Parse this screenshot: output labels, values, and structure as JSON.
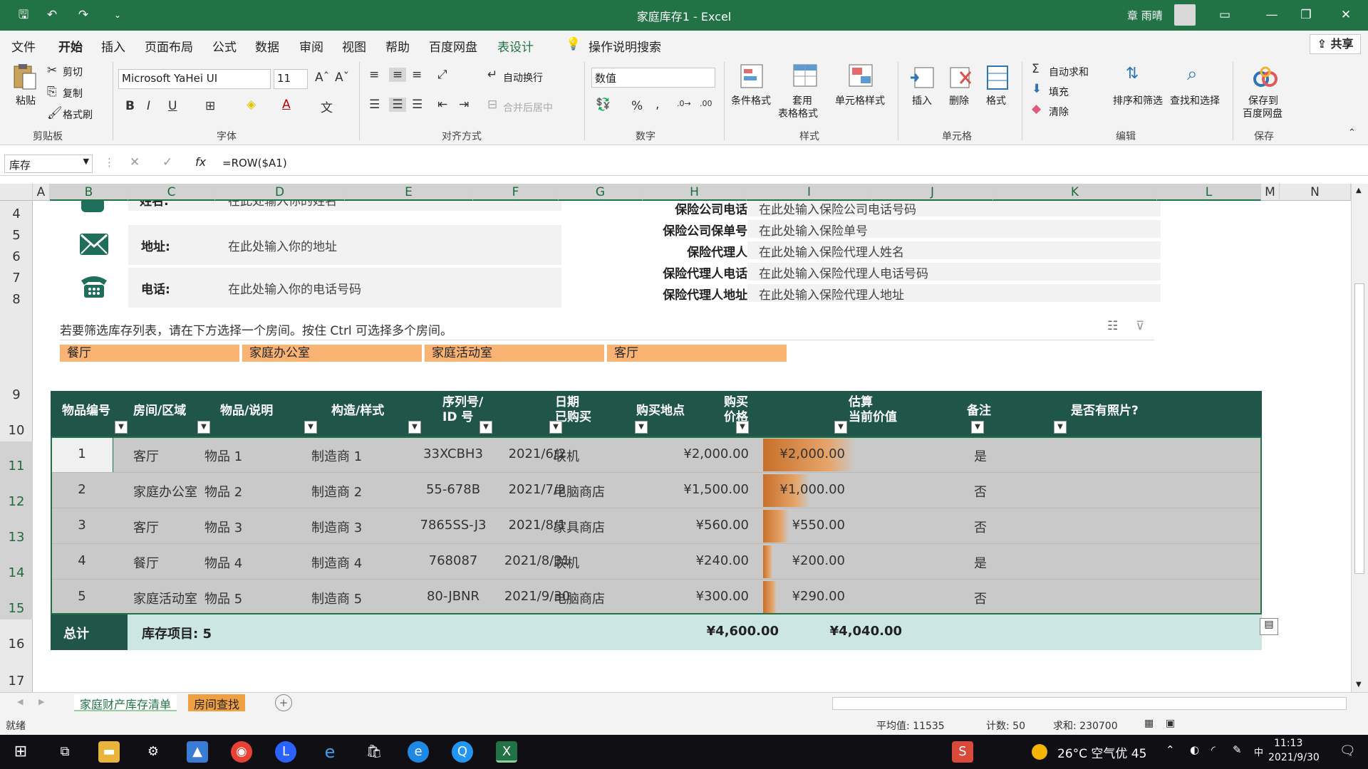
{
  "window": {
    "title": "家庭库存1  -  Excel",
    "user": "章 雨晴"
  },
  "menu": {
    "items": [
      "文件",
      "开始",
      "插入",
      "页面布局",
      "公式",
      "数据",
      "审阅",
      "视图",
      "帮助",
      "百度网盘",
      "表设计"
    ],
    "active": "开始",
    "search_label": "操作说明搜索",
    "share_label": "共享"
  },
  "ribbon": {
    "clipboard": {
      "paste": "粘贴",
      "cut": "剪切",
      "copy": "复制",
      "format_painter": "格式刷",
      "group": "剪贴板"
    },
    "font": {
      "name": "Microsoft YaHei UI",
      "size": "11",
      "bold": "B",
      "italic": "I",
      "underline": "U",
      "group": "字体"
    },
    "alignment": {
      "wrap": "自动换行",
      "merge": "合并后居中",
      "group": "对齐方式"
    },
    "number": {
      "format": "数值",
      "percent": "%",
      "comma": ",",
      "group": "数字"
    },
    "styles": {
      "conditional": "条件格式",
      "table_format_1": "套用",
      "table_format_2": "表格格式",
      "cell_styles": "单元格样式",
      "group": "样式"
    },
    "cells": {
      "insert": "插入",
      "delete": "删除",
      "format": "格式",
      "group": "单元格"
    },
    "editing": {
      "autosum": "自动求和",
      "fill": "填充",
      "clear": "清除",
      "sort_filter": "排序和筛选",
      "find_select": "查找和选择",
      "group": "编辑"
    },
    "save": {
      "save_to_1": "保存到",
      "save_to_2": "百度网盘",
      "group": "保存"
    }
  },
  "formula_bar": {
    "name_box": "库存",
    "formula": "=ROW($A1)",
    "fx": "fx"
  },
  "columns": [
    "A",
    "B",
    "C",
    "D",
    "E",
    "F",
    "G",
    "H",
    "I",
    "J",
    "K",
    "L",
    "M",
    "N"
  ],
  "rows": [
    "4",
    "5",
    "6",
    "7",
    "8",
    "9",
    "10",
    "11",
    "12",
    "13",
    "14",
    "15",
    "16",
    "17"
  ],
  "personal_info": {
    "name_label": "姓名:",
    "name_value": "在此处输入你的姓名",
    "address_label": "地址:",
    "address_value": "在此处输入你的地址",
    "phone_label": "电话:",
    "phone_value": "在此处输入你的电话号码"
  },
  "insurance_info": [
    {
      "label": "保险公司电话:",
      "value": "在此处输入保险公司电话号码"
    },
    {
      "label": "保险公司保单号:",
      "value": "在此处输入保险单号"
    },
    {
      "label": "保险代理人:",
      "value": "在此处输入保险代理人姓名"
    },
    {
      "label": "保险代理人电话:",
      "value": "在此处输入保险代理人电话号码"
    },
    {
      "label": "保险代理人地址:",
      "value": "在此处输入保险代理人地址"
    }
  ],
  "slicer": {
    "instruction": "若要筛选库存列表，请在下方选择一个房间。按住 Ctrl 可选择多个房间。",
    "buttons": [
      "餐厅",
      "家庭办公室",
      "家庭活动室",
      "客厅"
    ]
  },
  "table": {
    "headers": [
      {
        "line1": "物品编号",
        "line2": ""
      },
      {
        "line1": "房间/区域",
        "line2": ""
      },
      {
        "line1": "物品/说明",
        "line2": ""
      },
      {
        "line1": "构造/样式",
        "line2": ""
      },
      {
        "line1": "序列号/",
        "line2": "ID 号"
      },
      {
        "line1": "日期",
        "line2": "已购买"
      },
      {
        "line1": "购买地点",
        "line2": ""
      },
      {
        "line1": "购买",
        "line2": "价格"
      },
      {
        "line1": "估算",
        "line2": "当前价值"
      },
      {
        "line1": "备注",
        "line2": ""
      },
      {
        "line1": "是否有照片?",
        "line2": ""
      }
    ],
    "rows": [
      {
        "id": "1",
        "room": "客厅",
        "item": "物品 1",
        "make": "制造商 1",
        "serial": "33XCBH3",
        "date": "2021/6/2",
        "place": "联机",
        "price": "¥2,000.00",
        "value": "¥2,000.00",
        "value_ratio": 1.0,
        "note": "",
        "photo": "是"
      },
      {
        "id": "2",
        "room": "家庭办公室",
        "item": "物品 2",
        "make": "制造商 2",
        "serial": "55-678B",
        "date": "2021/7/2",
        "place": "电脑商店",
        "price": "¥1,500.00",
        "value": "¥1,000.00",
        "value_ratio": 0.5,
        "note": "",
        "photo": "否"
      },
      {
        "id": "3",
        "room": "客厅",
        "item": "物品 3",
        "make": "制造商 3",
        "serial": "7865SS-J3",
        "date": "2021/8/1",
        "place": "家具商店",
        "price": "¥560.00",
        "value": "¥550.00",
        "value_ratio": 0.275,
        "note": "",
        "photo": "否"
      },
      {
        "id": "4",
        "room": "餐厅",
        "item": "物品 4",
        "make": "制造商 4",
        "serial": "768087",
        "date": "2021/8/31",
        "place": "联机",
        "price": "¥240.00",
        "value": "¥200.00",
        "value_ratio": 0.1,
        "note": "",
        "photo": "是"
      },
      {
        "id": "5",
        "room": "家庭活动室",
        "item": "物品 5",
        "make": "制造商 5",
        "serial": "80-JBNR",
        "date": "2021/9/30",
        "place": "电脑商店",
        "price": "¥300.00",
        "value": "¥290.00",
        "value_ratio": 0.145,
        "note": "",
        "photo": "否"
      }
    ],
    "total": {
      "label": "总计",
      "count": "库存项目: 5",
      "price": "¥4,600.00",
      "value": "¥4,040.00"
    }
  },
  "sheet_tabs": [
    "家庭财产库存清单",
    "房间查找"
  ],
  "status": {
    "ready": "就绪",
    "average": "平均值: 11535",
    "count": "计数: 50",
    "sum": "求和: 230700"
  },
  "taskbar": {
    "weather": "26°C 空气优 45",
    "time": "11:13",
    "date": "2021/9/30",
    "ime": "中"
  },
  "colors": {
    "excel_green": "#217346",
    "table_header": "#1f5649",
    "slicer": "#f9b473",
    "databar": "#c8702a",
    "total_row": "#cce7e3"
  }
}
